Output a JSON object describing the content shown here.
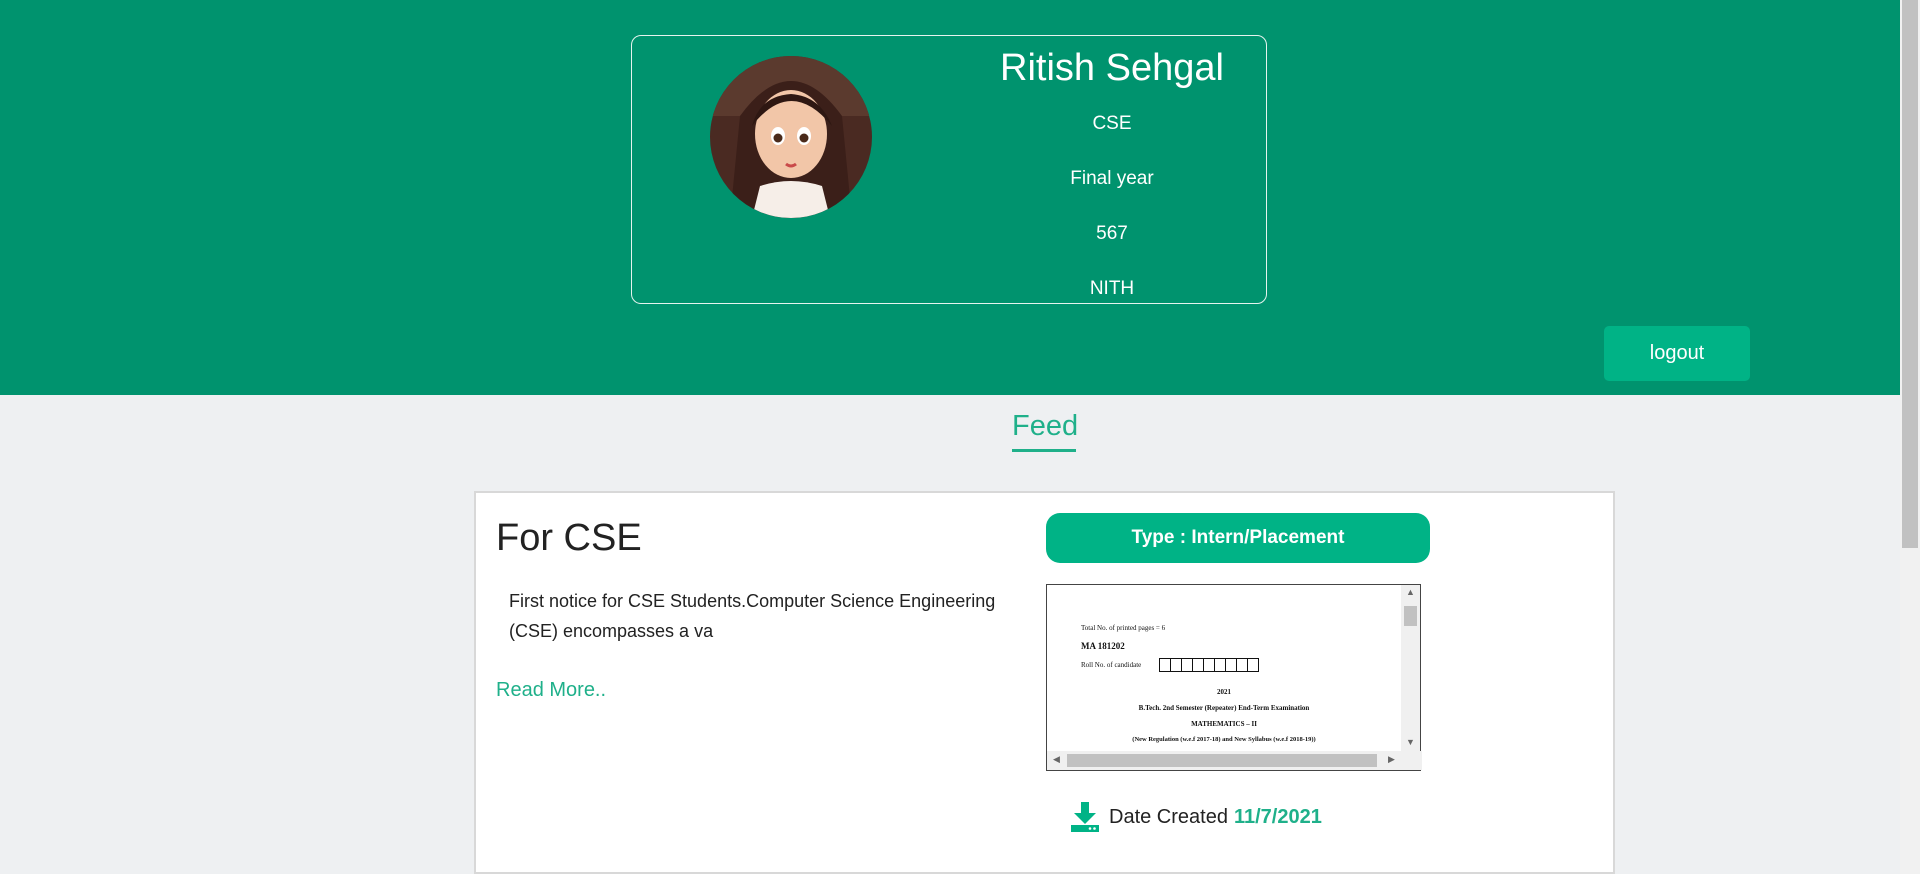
{
  "profile": {
    "name": "Ritish Sehgal",
    "branch": "CSE",
    "year": "Final year",
    "roll": "567",
    "college": "NITH"
  },
  "actions": {
    "logout_label": "logout"
  },
  "feed": {
    "title": "Feed",
    "posts": [
      {
        "title": "For CSE",
        "body": "First notice for CSE Students.Computer Science Engineering (CSE) encompasses a va",
        "read_more": "Read More..",
        "type": "Type : Intern/Placement",
        "date_label": "Date Created",
        "date_value": "11/7/2021",
        "pdf": {
          "pages_line": "Total No. of printed pages = 6",
          "code": "MA 181202",
          "roll_label": "Roll No. of candidate",
          "year": "2021",
          "exam": "B.Tech. 2nd Semester (Repeater) End-Term Examination",
          "subject": "MATHEMATICS – II",
          "regulation": "(New Regulation (w.e.f 2017-18) and New Syllabus (w.e.f 2018-19))"
        }
      }
    ]
  },
  "colors": {
    "header": "#00936e",
    "accent": "#00b386",
    "accent_text": "#1fb08a"
  },
  "icons": {
    "download": "download-icon"
  }
}
